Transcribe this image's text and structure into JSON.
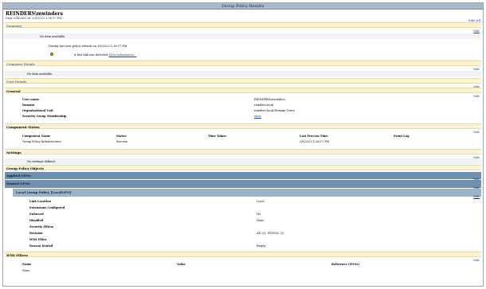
{
  "window": {
    "title": "Group Policy Results"
  },
  "header": {
    "user": "REINDERS\\mwinders",
    "date_line": "Data collected on: 2/8/2023 1:36:17 PM",
    "hide_all": "hide all"
  },
  "summary": {
    "label": "Summary",
    "hide": "hide",
    "no_data": "No data available.",
    "refresh_line": "During last user policy refresh on 2/8/2023 1:36:17 PM",
    "fast_link": "A fast link was detected",
    "more_info": "More information..."
  },
  "computer_details": {
    "label": "Computer Details",
    "hide": "hide",
    "no_data": "No data available."
  },
  "user_details": {
    "label": "User Details",
    "hide": "hide",
    "general": {
      "label": "General",
      "hide": "hide",
      "rows": [
        {
          "k": "User name",
          "v": "REINDERS\\mwinders"
        },
        {
          "k": "Domain",
          "v": "reinders.local"
        },
        {
          "k": "Organizational Unit",
          "v": "reinders.local/Domain Users"
        },
        {
          "k": "Security Group Membership",
          "v": "show"
        }
      ]
    },
    "component_status": {
      "label": "Component Status",
      "hide": "hide",
      "columns": [
        "Component Name",
        "Status",
        "Time Taken",
        "Last Process Time",
        "Event Log"
      ],
      "row": [
        "Group Policy Infrastructure",
        "Success",
        "",
        "2/8/2023 1:36:17 PM",
        ""
      ]
    },
    "settings": {
      "label": "Settings",
      "hide": "hide",
      "none": "No settings defined."
    },
    "gpo": {
      "label": "Group Policy Objects",
      "hide": "hide",
      "applied": {
        "label": "Applied GPOs",
        "hide": "hide"
      },
      "denied": {
        "label": "Denied GPOs",
        "hide": "hide"
      },
      "local": {
        "label": "Local Group Policy [LocalGPO]",
        "hide": "hide",
        "rows": [
          {
            "k": "Link Location",
            "v": "Local"
          },
          {
            "k": "Extensions Configured",
            "v": ""
          },
          {
            "k": "Enforced",
            "v": "No"
          },
          {
            "k": "Disabled",
            "v": "None"
          },
          {
            "k": "Security Filters",
            "v": ""
          },
          {
            "k": "Revision",
            "v": "AD (2), SYSVOL (2)"
          },
          {
            "k": "WMI Filter",
            "v": ""
          },
          {
            "k": "Reason Denied",
            "v": "Empty"
          }
        ]
      }
    },
    "wmi": {
      "label": "WMI Filters",
      "hide": "hide",
      "columns": [
        "Name",
        "Value",
        "Reference GPO(s)"
      ],
      "row": [
        "None",
        "",
        ""
      ]
    }
  }
}
